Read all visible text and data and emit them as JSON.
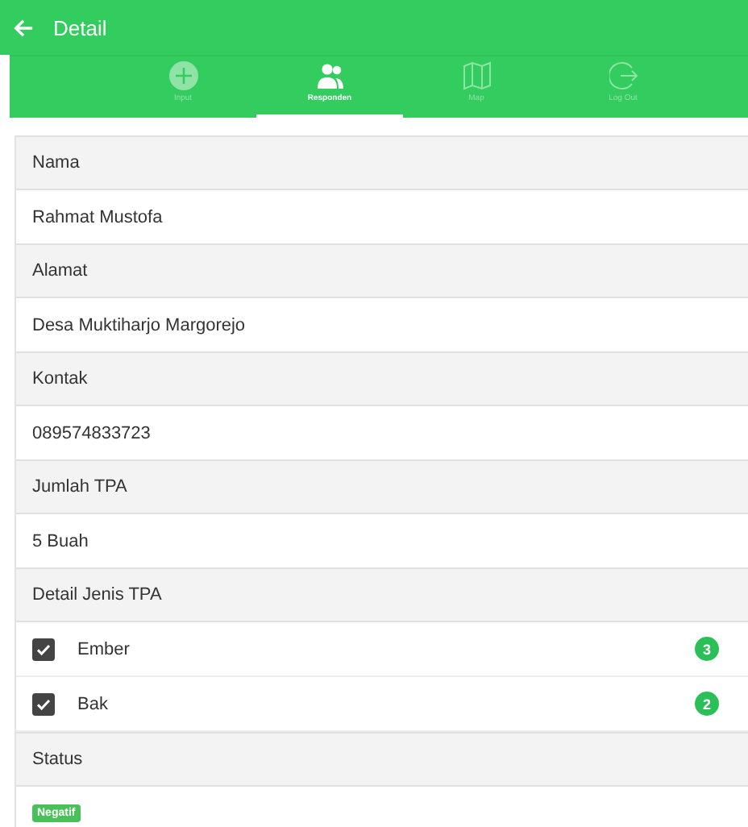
{
  "app_bar": {
    "title": "Detail"
  },
  "tabs": [
    {
      "label": "Input",
      "kind": "plus",
      "selected": false
    },
    {
      "label": "Responden",
      "kind": "people",
      "selected": true
    },
    {
      "label": "Map",
      "kind": "map",
      "selected": false
    },
    {
      "label": "Log Out",
      "kind": "logout",
      "selected": false
    }
  ],
  "sections": [
    {
      "header": "Nama",
      "kind": "text",
      "value": "Rahmat Mustofa"
    },
    {
      "header": "Alamat",
      "kind": "text",
      "value": "Desa Muktiharjo Margorejo"
    },
    {
      "header": "Kontak",
      "kind": "text",
      "value": "089574833723"
    },
    {
      "header": "Jumlah TPA",
      "kind": "text",
      "value": "5 Buah"
    },
    {
      "header": "Detail Jenis TPA",
      "kind": "checklist",
      "items": [
        {
          "label": "Ember",
          "checked": true,
          "count": "3"
        },
        {
          "label": "Bak",
          "checked": true,
          "count": "2"
        }
      ]
    },
    {
      "header": "Status",
      "kind": "badge",
      "value": "Negatif"
    }
  ]
}
